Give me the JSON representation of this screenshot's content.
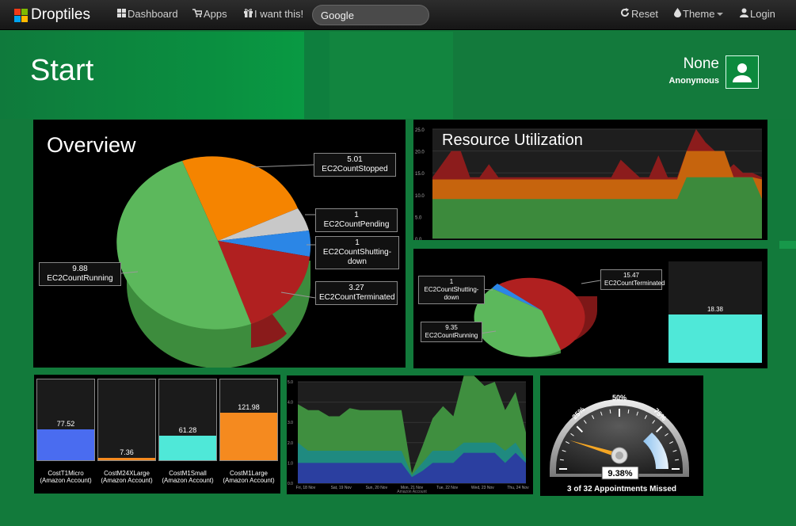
{
  "app": {
    "name": "Droptiles"
  },
  "nav": {
    "dashboard": "Dashboard",
    "apps": "Apps",
    "want": "I want this!",
    "search_value": "Google",
    "reset": "Reset",
    "theme": "Theme",
    "login": "Login"
  },
  "header": {
    "title": "Start",
    "user_name": "None",
    "user_role": "Anonymous"
  },
  "colors": {
    "background": "#127a3b",
    "green": "#5cb85c",
    "orange": "#f58400",
    "red": "#b02020",
    "blue": "#2b86e6",
    "grey": "#c8c8c8",
    "teal": "#4fe8d8"
  },
  "overview": {
    "title": "Overview",
    "chart_data": {
      "type": "pie",
      "slices": [
        {
          "name": "EC2CountStopped",
          "value": 5.01
        },
        {
          "name": "EC2CountPending",
          "value": 1
        },
        {
          "name": "EC2CountShutting-down",
          "value": 1
        },
        {
          "name": "EC2CountTerminated",
          "value": 3.27
        },
        {
          "name": "EC2CountRunning",
          "value": 9.88
        }
      ]
    }
  },
  "utilization": {
    "title": "Resource Utilization",
    "chart_data": {
      "type": "area",
      "ylim": [
        0,
        25
      ],
      "yticks": [
        "0.0",
        "5.0",
        "10.0",
        "15.0",
        "20.0",
        "25.0"
      ],
      "series": [
        {
          "name": "green",
          "values": [
            9,
            9,
            9,
            9,
            9,
            9,
            9,
            9,
            9,
            9,
            9,
            9,
            9,
            9,
            9,
            9,
            9,
            9,
            9,
            9,
            9,
            9,
            9,
            9,
            9,
            9,
            9,
            14,
            14,
            14,
            14,
            14,
            14,
            14,
            14,
            9
          ]
        },
        {
          "name": "orange",
          "values": [
            13.5,
            13.5,
            13.5,
            13.5,
            13.5,
            13.5,
            13.5,
            13.5,
            13.5,
            13.5,
            13.5,
            13.5,
            13.5,
            13.5,
            13.5,
            13.5,
            13.5,
            13.5,
            13.5,
            13.5,
            13.5,
            13.5,
            13.5,
            13.5,
            13.5,
            13.5,
            13.5,
            20,
            20,
            20,
            20,
            20,
            14,
            14,
            14,
            13.5
          ]
        },
        {
          "name": "red",
          "values": [
            14,
            17,
            20,
            20,
            14,
            14,
            17,
            14,
            14,
            14,
            14,
            14,
            14,
            14,
            14,
            14,
            14,
            14,
            14,
            14,
            18,
            16,
            14,
            14,
            19,
            14,
            14,
            20,
            25,
            22,
            20,
            15,
            17,
            15,
            15,
            14
          ]
        }
      ]
    }
  },
  "small_pie": {
    "chart_data": {
      "type": "pie",
      "slices": [
        {
          "name": "EC2CountTerminated",
          "value": 15.47
        },
        {
          "name": "EC2CountShutting-down",
          "value": 1
        },
        {
          "name": "EC2CountRunning",
          "value": 9.35
        }
      ]
    },
    "gauge_value": "18.38",
    "gauge_fraction": 0.48
  },
  "costs": {
    "chart_data": {
      "type": "bar",
      "bars": [
        {
          "value": "77.52",
          "label": "CostT1Micro (Amazon Account)",
          "fraction": 0.38,
          "color": "#4a6cf0"
        },
        {
          "value": "7.36",
          "label": "CostM24XLarge (Amazon Account)",
          "fraction": 0.03,
          "color": "#f58a1f"
        },
        {
          "value": "61.28",
          "label": "CostM1Small (Amazon Account)",
          "fraction": 0.3,
          "color": "#4fe8d8"
        },
        {
          "value": "121.98",
          "label": "CostM1Large (Amazon Account)",
          "fraction": 0.59,
          "color": "#f58a1f"
        }
      ]
    }
  },
  "area_small": {
    "chart_data": {
      "type": "area",
      "ylim": [
        0,
        5
      ],
      "yticks": [
        "0.0",
        "1.0",
        "2.0",
        "3.0",
        "4.0",
        "5.0"
      ],
      "x": [
        "Fri, 18 Nov",
        "Sat, 19 Nov",
        "Sun, 20 Nov",
        "Mon, 21 Nov",
        "Tue, 22 Nov",
        "Wed, 23 Nov",
        "Thu, 24 Nov"
      ],
      "xlabel": "Amazon Account",
      "series": [
        {
          "name": "blue",
          "values": [
            1,
            1,
            1,
            1,
            1,
            1,
            1,
            1,
            1,
            1,
            1,
            0.3,
            0.6,
            1,
            1,
            1,
            1.5,
            1.5,
            1.5,
            1.5,
            1,
            1.5,
            1
          ]
        },
        {
          "name": "teal",
          "values": [
            2,
            1.6,
            1.6,
            1.6,
            1.6,
            1.6,
            1.6,
            1.6,
            1.6,
            1.6,
            1.6,
            0.4,
            1,
            1.6,
            1.6,
            1.6,
            2,
            2,
            2,
            2,
            1.6,
            2,
            1.2
          ]
        },
        {
          "name": "green",
          "values": [
            3.9,
            3.6,
            3.6,
            3.3,
            3.3,
            3.7,
            3.6,
            3.6,
            3.6,
            3.6,
            3.6,
            0.5,
            1.8,
            3.2,
            3.8,
            3.3,
            5.3,
            5.3,
            4.8,
            5,
            3.6,
            4.5,
            2.5
          ]
        }
      ]
    }
  },
  "gauge": {
    "ticks": [
      "25%",
      "50%",
      "75%"
    ],
    "value_label": "9.38%",
    "value": 9.38,
    "caption": "3 of 32 Appointments Missed"
  }
}
